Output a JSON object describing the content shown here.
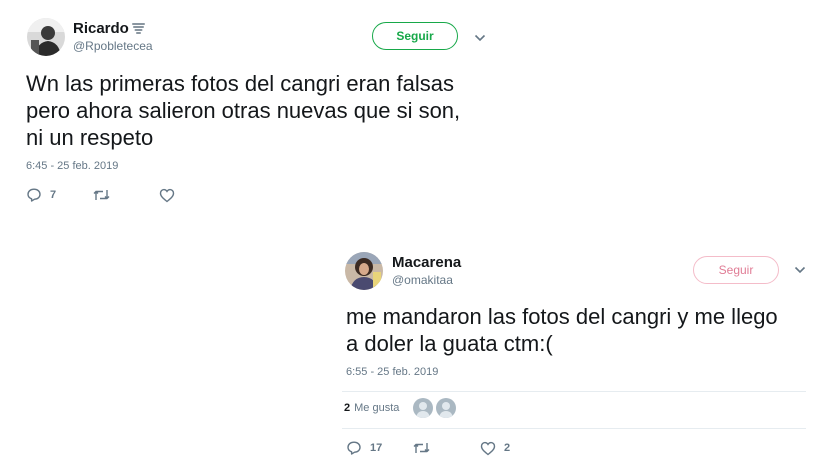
{
  "tweets": [
    {
      "user": {
        "display_name": "Ricardo",
        "handle": "@Rpobletecea",
        "name_emoji": "tornado-icon"
      },
      "follow_label": "Seguir",
      "text": "Wn las primeras fotos del cangri eran falsas\npero ahora salieron otras nuevas que si son,\nni un respeto",
      "timestamp": "6:45 - 25 feb. 2019",
      "actions": {
        "reply_count": "7",
        "retweet_count": "",
        "like_count": ""
      }
    },
    {
      "user": {
        "display_name": "Macarena",
        "handle": "@omakitaa"
      },
      "follow_label": "Seguir",
      "text": "me mandaron las fotos del cangri y me llego\na doler la guata ctm:(",
      "timestamp": "6:55 - 25 feb. 2019",
      "likes": {
        "count": "2",
        "label": "Me gusta"
      },
      "actions": {
        "reply_count": "17",
        "retweet_count": "",
        "like_count": "2"
      }
    }
  ],
  "colors": {
    "follow_green": "#17a849",
    "follow_pink": "#e07c95",
    "muted": "#657786",
    "text": "#14171a"
  }
}
